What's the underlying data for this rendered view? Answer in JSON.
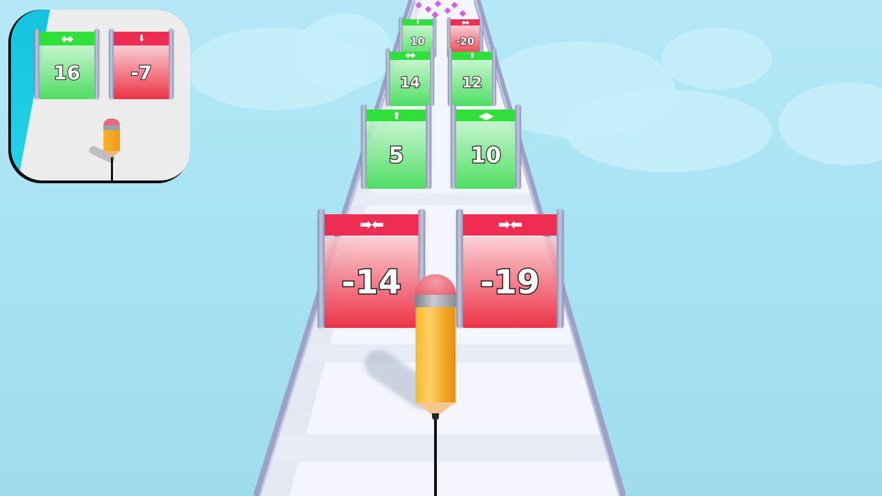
{
  "colors": {
    "sky": "#a6e2f3",
    "track": "#f3f6fb",
    "rail": "#9ba2c6",
    "gate_green": "#2fe03a",
    "gate_red": "#ef2c52",
    "pencil_body": "#f6b928",
    "pencil_eraser": "#e9707f",
    "app_icon_bg": "#14c3df",
    "gem": "#d75ee8"
  },
  "app_icon": {
    "gates": [
      {
        "type": "green",
        "symbol": "◆◆",
        "value": "16"
      },
      {
        "type": "red",
        "symbol": "⬇",
        "value": "-7"
      }
    ]
  },
  "gates": [
    {
      "id": "row1-left",
      "type": "green",
      "symbol": "⬆",
      "value": "10"
    },
    {
      "id": "row1-right",
      "type": "red",
      "symbol": "◆◆",
      "value": "-20"
    },
    {
      "id": "row2-left",
      "type": "green",
      "symbol": "◆◆",
      "value": "14"
    },
    {
      "id": "row2-right",
      "type": "green",
      "symbol": "⬆",
      "value": "12"
    },
    {
      "id": "row3-left",
      "type": "green",
      "symbol": "⬆",
      "value": "5"
    },
    {
      "id": "row3-right",
      "type": "green",
      "symbol": "◀▶",
      "value": "10"
    },
    {
      "id": "row4-left",
      "type": "red",
      "symbol": "➡⬅",
      "value": "-14"
    },
    {
      "id": "row4-right",
      "type": "red",
      "symbol": "➡⬅",
      "value": "-19"
    }
  ]
}
